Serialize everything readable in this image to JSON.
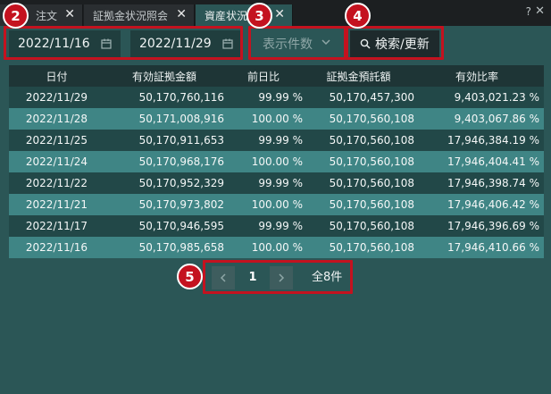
{
  "tabs": [
    {
      "label": "注文"
    },
    {
      "label": "証拠金状況照会"
    },
    {
      "label": "資産状況"
    }
  ],
  "toolbar": {
    "date_from": "2022/11/16",
    "date_to": "2022/11/29",
    "page_size_label": "表示件数",
    "search_label": "検索/更新"
  },
  "badges": [
    "2",
    "3",
    "4",
    "5"
  ],
  "table": {
    "headers": [
      "日付",
      "有効証拠金額",
      "前日比",
      "証拠金預託額",
      "有効比率"
    ],
    "rows": [
      [
        "2022/11/29",
        "50,170,760,116",
        "99.99 %",
        "50,170,457,300",
        "9,403,021.23 %"
      ],
      [
        "2022/11/28",
        "50,171,008,916",
        "100.00 %",
        "50,170,560,108",
        "9,403,067.86 %"
      ],
      [
        "2022/11/25",
        "50,170,911,653",
        "99.99 %",
        "50,170,560,108",
        "17,946,384.19 %"
      ],
      [
        "2022/11/24",
        "50,170,968,176",
        "100.00 %",
        "50,170,560,108",
        "17,946,404.41 %"
      ],
      [
        "2022/11/22",
        "50,170,952,329",
        "99.99 %",
        "50,170,560,108",
        "17,946,398.74 %"
      ],
      [
        "2022/11/21",
        "50,170,973,802",
        "100.00 %",
        "50,170,560,108",
        "17,946,406.42 %"
      ],
      [
        "2022/11/17",
        "50,170,946,595",
        "99.99 %",
        "50,170,560,108",
        "17,946,396.69 %"
      ],
      [
        "2022/11/16",
        "50,170,985,658",
        "100.00 %",
        "50,170,560,108",
        "17,946,410.66 %"
      ]
    ]
  },
  "pagination": {
    "current_page": "1",
    "total_label": "全8件"
  },
  "colors": {
    "highlight": "#c4121f",
    "background": "#2b5656",
    "row_odd": "#224848",
    "row_even": "#3f8585"
  },
  "icons": [
    "close-icon",
    "help-icon",
    "calendar-icon",
    "chevron-down-icon",
    "search-icon",
    "chevron-left-icon",
    "chevron-right-icon"
  ]
}
